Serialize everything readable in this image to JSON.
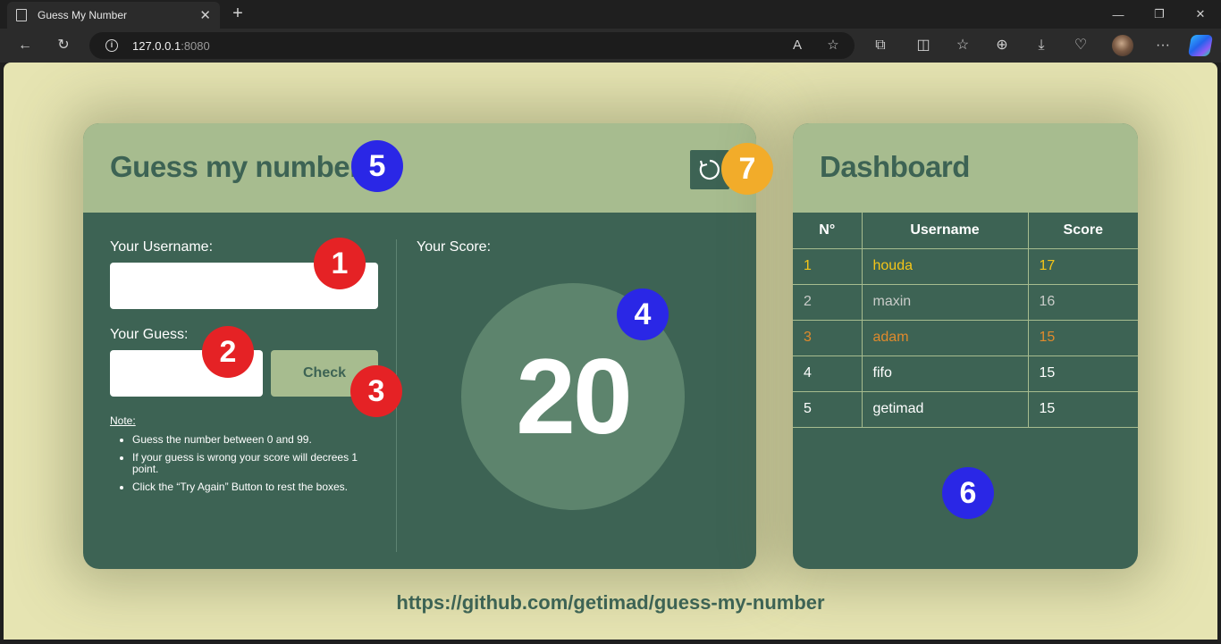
{
  "browser": {
    "tab_title": "Guess My Number",
    "url_host": "127.0.0.1",
    "url_port": ":8080"
  },
  "game": {
    "title": "Guess my number",
    "username_label": "Your Username:",
    "username_value": "",
    "guess_label": "Your Guess:",
    "guess_value": "",
    "check_label": "Check",
    "note_title": "Note:",
    "notes": [
      "Guess the number between 0 and 99.",
      "If your guess is wrong your score will decrees 1 point.",
      "Click the “Try Again” Button to rest the boxes."
    ],
    "score_label": "Your Score:",
    "score_value": "20"
  },
  "dashboard": {
    "title": "Dashboard",
    "columns": [
      "N°",
      "Username",
      "Score"
    ],
    "rows": [
      {
        "n": "1",
        "username": "houda",
        "score": "17",
        "color": "#f5c518"
      },
      {
        "n": "2",
        "username": "maxin",
        "score": "16",
        "color": "#c9ccc9"
      },
      {
        "n": "3",
        "username": "adam",
        "score": "15",
        "color": "#e08a2c"
      },
      {
        "n": "4",
        "username": "fifo",
        "score": "15",
        "color": "#ffffff"
      },
      {
        "n": "5",
        "username": "getimad",
        "score": "15",
        "color": "#ffffff"
      }
    ]
  },
  "footer_url": "https://github.com/getimad/guess-my-number",
  "annotations": {
    "b1": "1",
    "b2": "2",
    "b3": "3",
    "b4": "4",
    "b5": "5",
    "b6": "6",
    "b7": "7"
  },
  "colors": {
    "page_bg": "#e6e4b2",
    "card_dark": "#3d6354",
    "card_head": "#a7bc8f",
    "score_circle": "#5d846d",
    "badge_red": "#e52225",
    "badge_blue": "#2a27e6",
    "badge_orange": "#f2ac2a"
  }
}
